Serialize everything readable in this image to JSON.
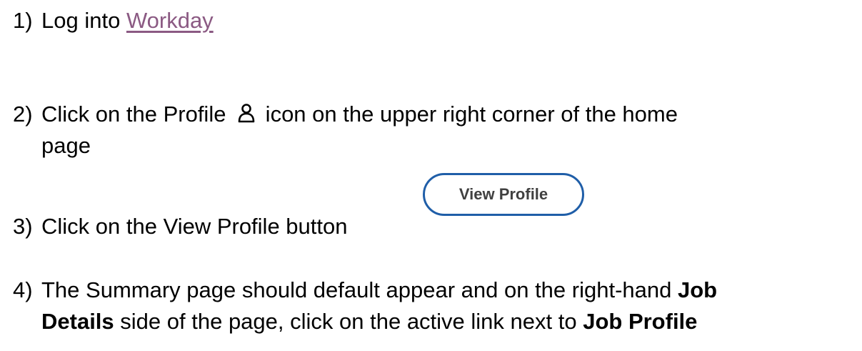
{
  "steps": [
    {
      "number": "1)",
      "text": "Log into ",
      "link": "Workday"
    },
    {
      "number": "2)",
      "text_before": "Click on the Profile ",
      "icon": "person-outline-icon",
      "text_after": " icon on the upper right corner of the home",
      "continuation": "page"
    },
    {
      "number": "3)",
      "text": "Click on the View Profile button",
      "button_label": "View Profile"
    },
    {
      "number": "4)",
      "line1_text": "The Summary page should default appear and on the right-hand ",
      "line1_bold": "Job",
      "line2_bold1": "Details",
      "line2_text": " side of the page, click on the active link next to ",
      "line2_bold2": "Job Profile"
    }
  ],
  "colors": {
    "link": "#8b5a83",
    "button_border": "#1f5ea8",
    "button_text": "#404040"
  }
}
